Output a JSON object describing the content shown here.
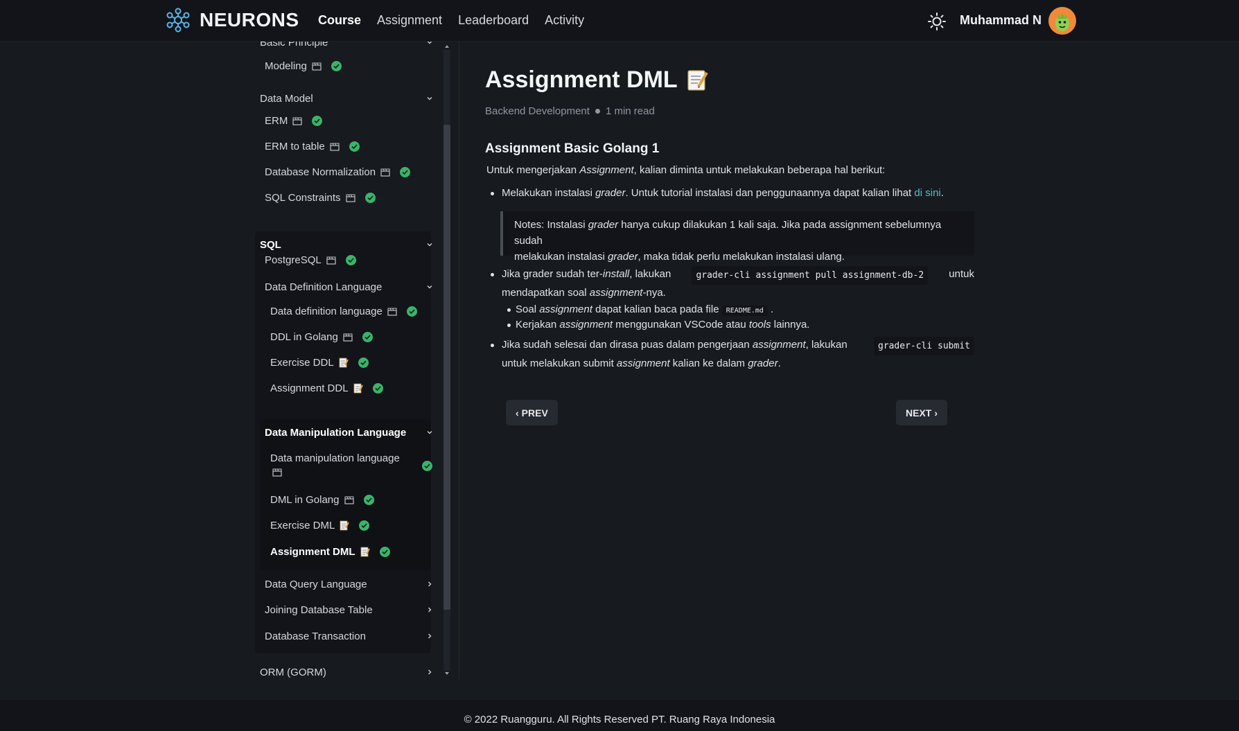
{
  "header": {
    "brand": "NEURONS",
    "nav": [
      "Course",
      "Assignment",
      "Leaderboard",
      "Activity"
    ],
    "active_nav": "Course",
    "username": "Muhammad N"
  },
  "sidebar": {
    "items": [
      {
        "label": "Basic Principle",
        "type": "group",
        "chevron": "down"
      },
      {
        "label": "Modeling",
        "icon": "clapperboard",
        "done": true
      },
      {
        "label": "Data Model",
        "type": "group",
        "chevron": "down"
      },
      {
        "label": "ERM",
        "icon": "clapperboard",
        "done": true
      },
      {
        "label": "ERM to table",
        "icon": "clapperboard",
        "done": true
      },
      {
        "label": "Database Normalization",
        "icon": "clapperboard",
        "done": true
      },
      {
        "label": "SQL Constraints",
        "icon": "clapperboard",
        "done": true
      },
      {
        "label": "SQL",
        "type": "group",
        "chevron": "down"
      },
      {
        "label": "PostgreSQL",
        "icon": "clapperboard",
        "done": true
      },
      {
        "label": "Data Definition Language",
        "type": "subgroup",
        "chevron": "down"
      },
      {
        "label": "Data definition language",
        "icon": "clapperboard",
        "done": true
      },
      {
        "label": "DDL in Golang",
        "icon": "clapperboard",
        "done": true
      },
      {
        "label": "Exercise DDL",
        "icon": "memo",
        "done": true
      },
      {
        "label": "Assignment DDL",
        "icon": "memo",
        "done": true
      },
      {
        "label": "Data Manipulation Language",
        "type": "subgroup",
        "chevron": "down"
      },
      {
        "label": "Data manipulation language",
        "icon": "clapperboard",
        "done": true
      },
      {
        "label": "DML in Golang",
        "icon": "clapperboard",
        "done": true
      },
      {
        "label": "Exercise DML",
        "icon": "memo",
        "done": true
      },
      {
        "label": "Assignment DML",
        "icon": "memo",
        "done": true,
        "active": true
      },
      {
        "label": "Data Query Language",
        "type": "subgroup",
        "chevron": "right"
      },
      {
        "label": "Joining Database Table",
        "type": "subgroup",
        "chevron": "right"
      },
      {
        "label": "Database Transaction",
        "type": "subgroup",
        "chevron": "right"
      },
      {
        "label": "ORM (GORM)",
        "type": "group",
        "chevron": "right"
      }
    ]
  },
  "content": {
    "title": "Assignment DML",
    "category": "Backend Development",
    "read_time": "1 min read",
    "section_title": "Assignment Basic Golang 1",
    "intro_pre": "Untuk mengerjakan ",
    "intro_em": "Assignment",
    "intro_post": ", kalian diminta untuk melakukan beberapa hal berikut:",
    "b1_pre": "Melakukan instalasi ",
    "b1_em": "grader",
    "b1_post": ". Untuk tutorial instalasi dan penggunaannya dapat kalian lihat ",
    "b1_link": "di sini",
    "b1_end": ".",
    "note_1a": "Notes: Instalasi ",
    "note_1b": "grader",
    "note_1c": " hanya cukup dilakukan 1 kali saja. Jika pada assignment sebelumnya sudah",
    "note_2a": "melakukan instalasi ",
    "note_2b": "grader",
    "note_2c": ", maka tidak perlu melakukan instalasi ulang.",
    "b2_pre": "Jika grader sudah ter-",
    "b2_em": "install",
    "b2_mid": ", lakukan ",
    "b2_code": "grader-cli assignment pull assignment-db-2",
    "b2_post": " untuk",
    "b2_line2_pre": "mendapatkan soal ",
    "b2_line2_em": "assignment",
    "b2_line2_post": "-nya.",
    "sub1_pre": "Soal ",
    "sub1_em": "assignment",
    "sub1_mid": " dapat kalian baca pada file ",
    "sub1_code": "README.md",
    "sub1_post": " .",
    "sub2_pre": "Kerjakan ",
    "sub2_em": "assignment",
    "sub2_mid": " menggunakan VSCode atau ",
    "sub2_em2": "tools",
    "sub2_post": " lainnya.",
    "b3_pre": "Jika sudah selesai dan dirasa puas dalam pengerjaan ",
    "b3_em": "assignment",
    "b3_mid": ", lakukan ",
    "b3_code": "grader-cli submit",
    "b3_line2_pre": "untuk melakukan submit ",
    "b3_line2_em": "assignment",
    "b3_line2_mid": " kalian ke dalam ",
    "b3_line2_em2": "grader",
    "b3_line2_end": "."
  },
  "pager": {
    "prev": "PREV",
    "next": "NEXT"
  },
  "footer": {
    "text": "© 2022 Ruangguru. All Rights Reserved PT. Ruang Raya Indonesia"
  },
  "colors": {
    "accent": "#4cc3c8",
    "check": "#3bb36b",
    "avatar": "#f08a38"
  }
}
